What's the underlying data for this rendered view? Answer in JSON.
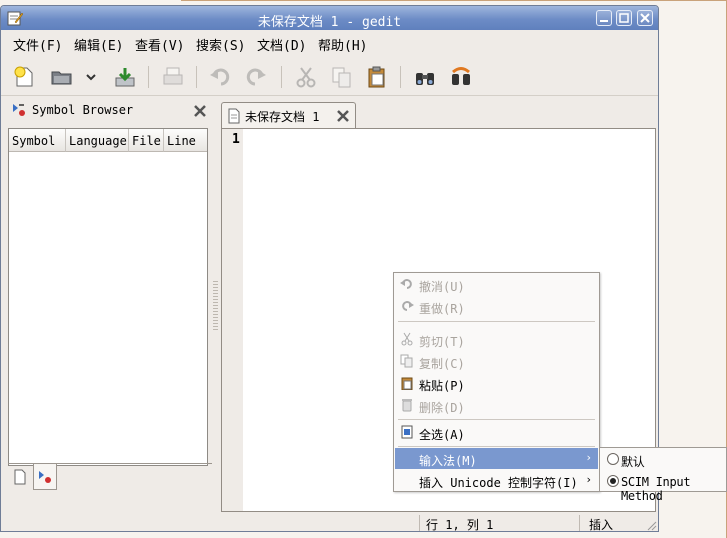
{
  "window": {
    "title": "未保存文档 1 - gedit"
  },
  "menubar": {
    "items": [
      "文件(F)",
      "编辑(E)",
      "查看(V)",
      "搜索(S)",
      "文档(D)",
      "帮助(H)"
    ]
  },
  "side_panel": {
    "title": "Symbol Browser",
    "columns": [
      "Symbol",
      "Language",
      "File",
      "Line"
    ]
  },
  "document_tab": {
    "label": "未保存文档 1"
  },
  "editor": {
    "line_number": "1"
  },
  "status_bar": {
    "position": "行 1, 列 1",
    "mode": "插入"
  },
  "context_menu": {
    "undo": "撤消(U)",
    "redo": "重做(R)",
    "cut": "剪切(T)",
    "copy": "复制(C)",
    "paste": "粘贴(P)",
    "delete": "删除(D)",
    "select_all": "全选(A)",
    "input_method": "输入法(M)",
    "insert_unicode": "插入 Unicode 控制字符(I)"
  },
  "input_method_submenu": {
    "default": "默认",
    "scim": "SCIM Input Method",
    "selected": "scim"
  },
  "colors": {
    "titlebar": "#6d8cc6",
    "highlight": "#7a98cf",
    "window_bg": "#efebe7"
  }
}
